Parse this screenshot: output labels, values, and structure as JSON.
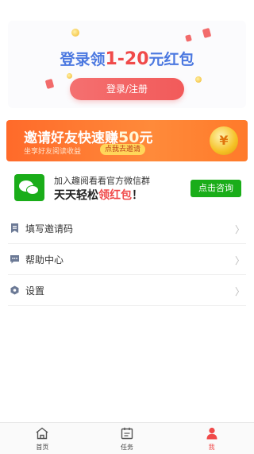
{
  "login": {
    "title_prefix": "登录领",
    "title_highlight": "1-20",
    "title_suffix": "元红包",
    "button_label": "登录/注册"
  },
  "invite_banner": {
    "title_prefix": "邀请好友快速赚",
    "title_amount": "50",
    "title_unit": "元",
    "subtitle": "坐享好友阅读收益",
    "button_label": "点我去邀请",
    "coin_symbol": "¥"
  },
  "wechat": {
    "line1": "加入趣阅看看官方微信群",
    "line2_prefix": "天天轻松",
    "line2_highlight": "领红包",
    "line2_suffix": "！",
    "button_label": "点击咨询"
  },
  "menu": {
    "items": [
      {
        "label": "填写邀请码",
        "icon": "invite-code-icon"
      },
      {
        "label": "帮助中心",
        "icon": "help-icon"
      },
      {
        "label": "设置",
        "icon": "settings-icon"
      }
    ],
    "chevron": "〉"
  },
  "tabbar": {
    "tabs": [
      {
        "label": "首页",
        "icon": "home-icon"
      },
      {
        "label": "任务",
        "icon": "task-icon"
      },
      {
        "label": "我",
        "icon": "user-icon",
        "active": true
      }
    ]
  },
  "colors": {
    "accent_red": "#f04a4a",
    "title_blue": "#4b78e0",
    "wechat_green": "#1aad19",
    "banner_orange": "#ff7a2a"
  }
}
